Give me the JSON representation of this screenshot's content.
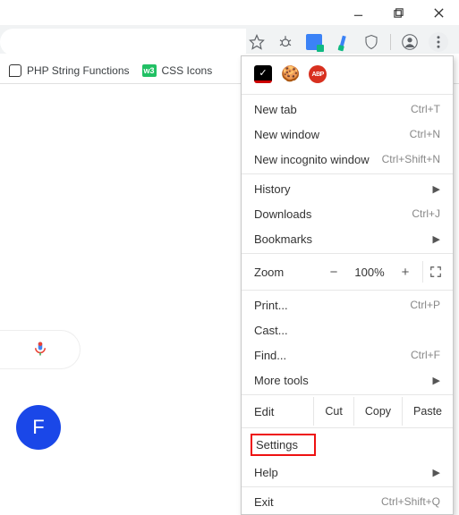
{
  "window": {
    "minimize": "minimize",
    "maximize": "maximize",
    "close": "close"
  },
  "bookmarks": [
    {
      "label": "PHP String Functions"
    },
    {
      "label": "CSS Icons"
    }
  ],
  "ext_icons": {
    "star": "star",
    "bug": "bug",
    "translate": "translate",
    "picker": "picker",
    "shield": "shield",
    "profile": "profile",
    "menu": "menu",
    "ghostery": "ghostery",
    "cookie": "🍪",
    "abp": "ABP"
  },
  "menu": {
    "new_tab": {
      "label": "New tab",
      "shortcut": "Ctrl+T"
    },
    "new_window": {
      "label": "New window",
      "shortcut": "Ctrl+N"
    },
    "incognito": {
      "label": "New incognito window",
      "shortcut": "Ctrl+Shift+N"
    },
    "history": {
      "label": "History"
    },
    "downloads": {
      "label": "Downloads",
      "shortcut": "Ctrl+J"
    },
    "bookmarks": {
      "label": "Bookmarks"
    },
    "zoom": {
      "label": "Zoom",
      "value": "100%",
      "minus": "−",
      "plus": "+"
    },
    "print": {
      "label": "Print...",
      "shortcut": "Ctrl+P"
    },
    "cast": {
      "label": "Cast..."
    },
    "find": {
      "label": "Find...",
      "shortcut": "Ctrl+F"
    },
    "more_tools": {
      "label": "More tools"
    },
    "edit": {
      "label": "Edit",
      "cut": "Cut",
      "copy": "Copy",
      "paste": "Paste"
    },
    "settings": {
      "label": "Settings"
    },
    "help": {
      "label": "Help"
    },
    "exit": {
      "label": "Exit",
      "shortcut": "Ctrl+Shift+Q"
    }
  },
  "avatar_letter": "F"
}
